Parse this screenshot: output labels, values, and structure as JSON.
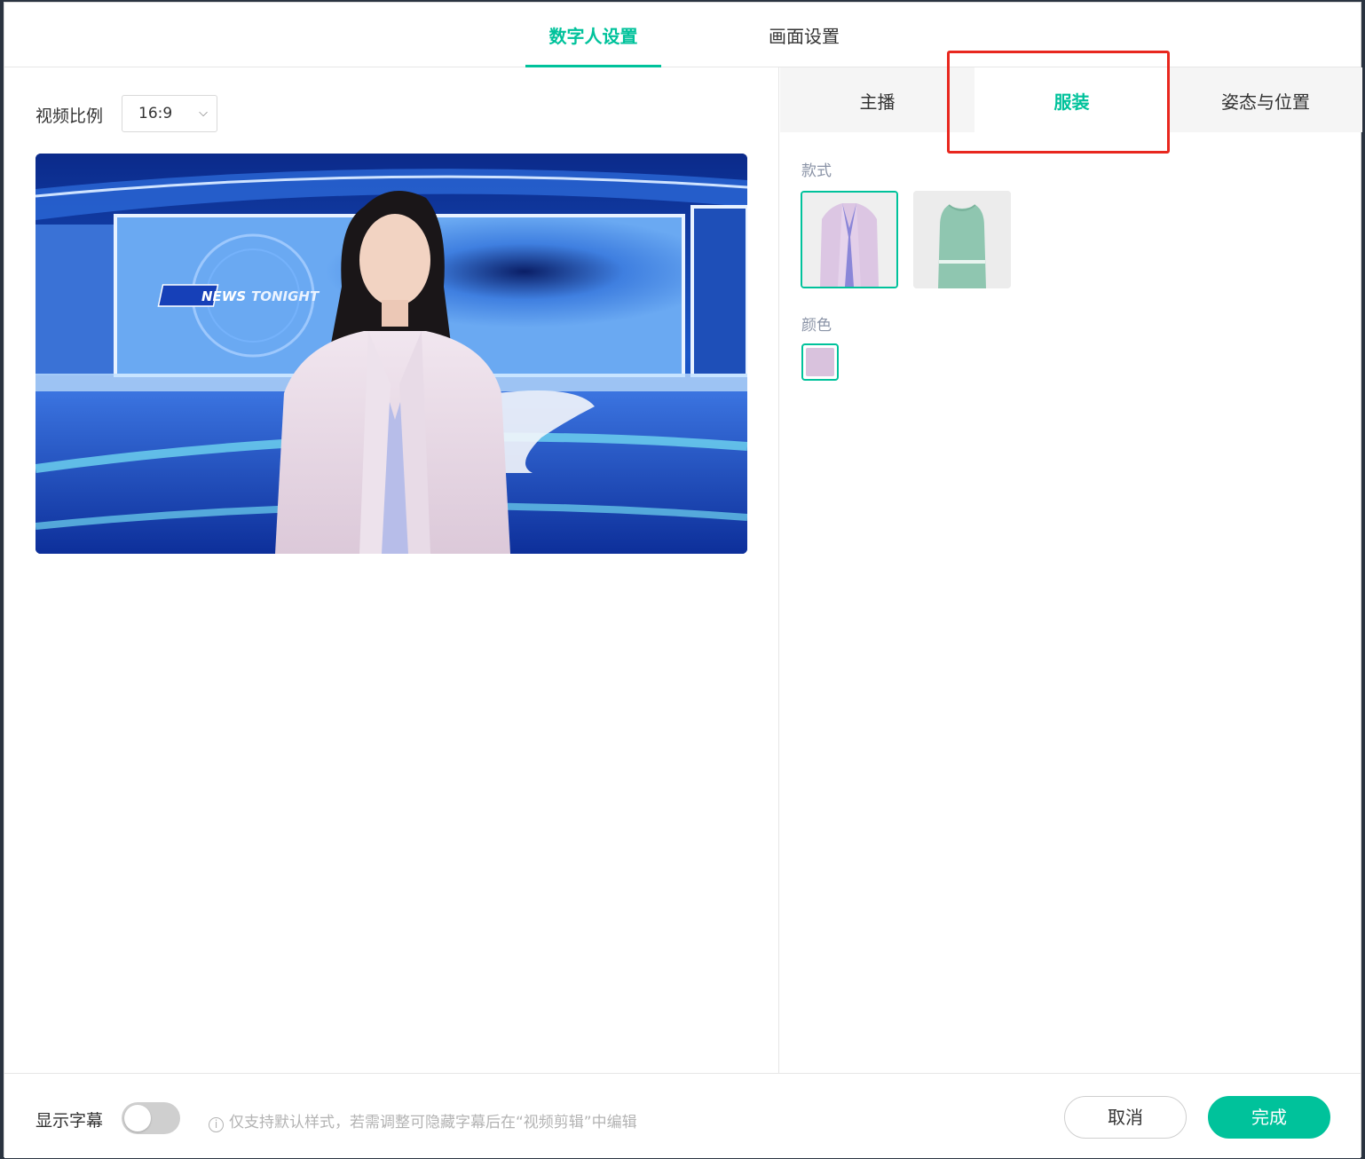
{
  "top_tabs": [
    {
      "label": "数字人设置",
      "active": true
    },
    {
      "label": "画面设置",
      "active": false
    }
  ],
  "left": {
    "ratio_label": "视频比例",
    "ratio_value": "16:9",
    "preview_text_news": "NEWS",
    "preview_text_tonight": "TONIGHT"
  },
  "sub_tabs": [
    {
      "label": "主播",
      "active": false
    },
    {
      "label": "服装",
      "active": true
    },
    {
      "label": "姿态与位置",
      "active": false
    }
  ],
  "outfit": {
    "style_label": "款式",
    "color_label": "颜色",
    "styles": [
      "suit-jacket",
      "sleeveless-dress"
    ],
    "selected_style": 0,
    "selected_color": "#d9c2dd"
  },
  "footer": {
    "subtitle_label": "显示字幕",
    "subtitle_on": false,
    "hint": "仅支持默认样式，若需调整可隐藏字幕后在“视频剪辑”中编辑",
    "cancel_label": "取消",
    "done_label": "完成"
  },
  "colors": {
    "accent": "#00c29b",
    "highlight_box": "#e8271e"
  }
}
